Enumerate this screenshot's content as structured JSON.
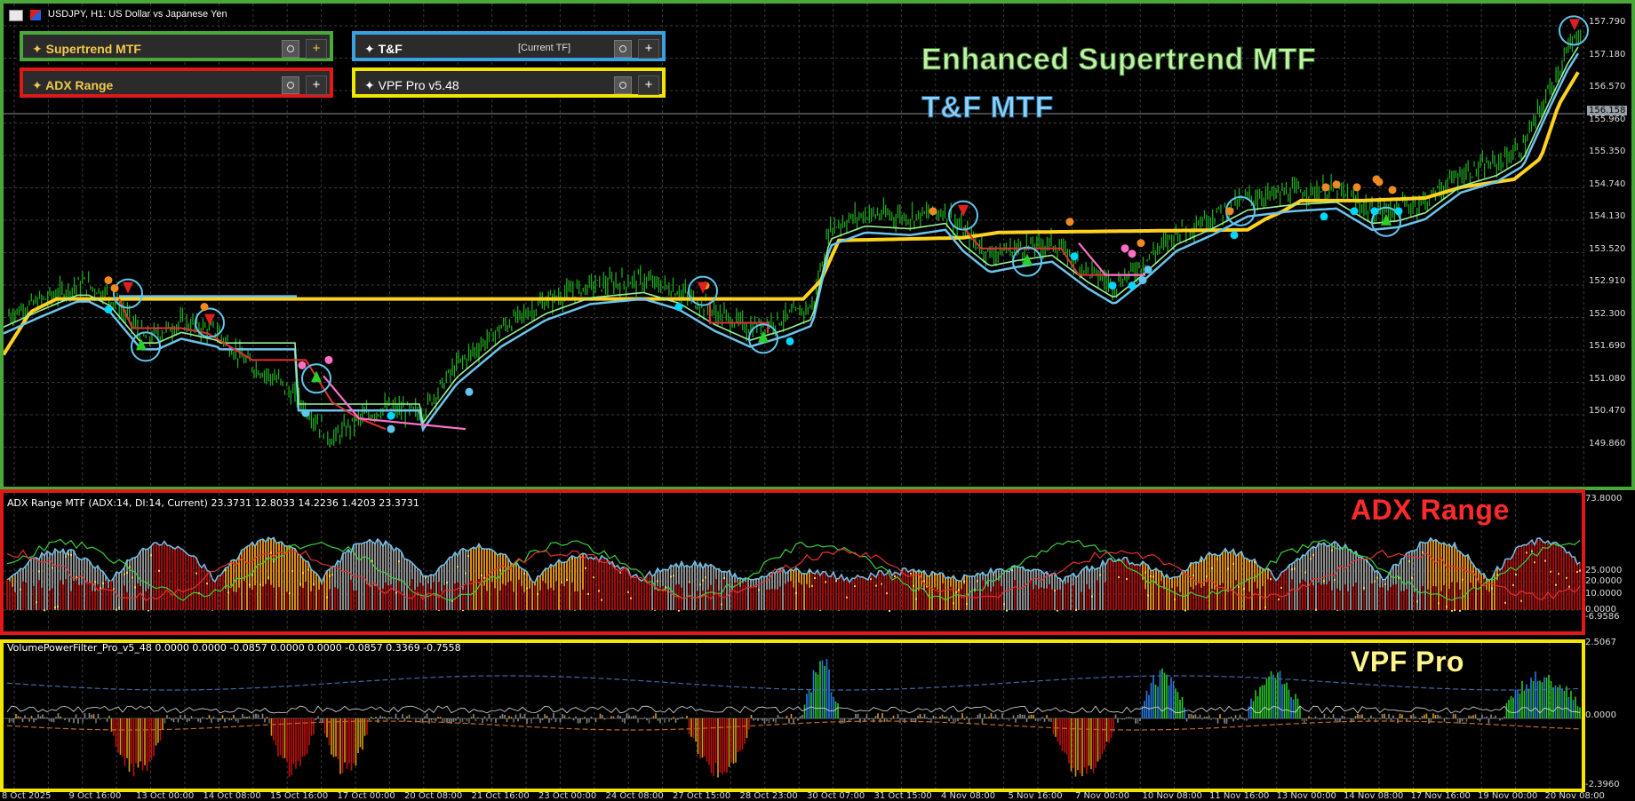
{
  "window": {
    "title": "USDJPY, H1:  US Dollar vs Japanese Yen"
  },
  "indicator_panels": {
    "supertrend": {
      "label": "✦ Supertrend MTF",
      "plus": "+",
      "color": "#f2c94c",
      "border": "#4aa83a"
    },
    "adx": {
      "label": "✦ ADX Range",
      "plus": "+",
      "color": "#f2c94c",
      "border": "#e01818"
    },
    "tf": {
      "label": "✦ T&F",
      "middle": "[Current TF]",
      "plus": "+",
      "color": "#ffffff",
      "border": "#3aa0e0"
    },
    "vpf": {
      "label": "✦ VPF Pro v5.48",
      "plus": "+",
      "color": "#ffffff",
      "border": "#f2e600"
    }
  },
  "overlay_titles": {
    "line1": "Enhanced Supertrend MTF",
    "line2": "T&F MTF",
    "adx": "ADX Range",
    "vpf": "VPF Pro"
  },
  "price_axis": {
    "ticks": [
      "157.790",
      "157.180",
      "156.570",
      "155.960",
      "155.350",
      "154.740",
      "154.130",
      "153.520",
      "152.910",
      "152.300",
      "151.690",
      "151.080",
      "150.470",
      "149.860"
    ],
    "current_price": "156.158"
  },
  "adx_subwindow": {
    "header": "ADX Range MTF (ADX:14, DI:14, Current) 23.3731 12.8033 14.2236 1.4203 23.3731",
    "ticks": [
      "73.8000",
      "25.0000",
      "20.0000",
      "10.0000",
      "0.0000",
      "-6.9586"
    ]
  },
  "vpf_subwindow": {
    "header": "VolumePowerFilter_Pro_v5_48 0.0000 0.0000 -0.0857 0.0000 0.0000 -0.0857 0.3369 -0.7558",
    "ticks": [
      "2.5067",
      "0.0000",
      "-2.3960"
    ]
  },
  "time_axis": [
    "8 Oct 2025",
    "9 Oct 16:00",
    "13 Oct 00:00",
    "14 Oct 08:00",
    "15 Oct 16:00",
    "17 Oct 00:00",
    "20 Oct 08:00",
    "21 Oct 16:00",
    "23 Oct 00:00",
    "24 Oct 08:00",
    "27 Oct 15:00",
    "28 Oct 23:00",
    "30 Oct 07:00",
    "31 Oct 15:00",
    "4 Nov 08:00",
    "5 Nov 16:00",
    "7 Nov 00:00",
    "10 Nov 08:00",
    "11 Nov 16:00",
    "13 Nov 00:00",
    "14 Nov 08:00",
    "17 Nov 16:00",
    "19 Nov 00:00",
    "20 Nov 08:00"
  ],
  "colors": {
    "candle_up": "#1fa81f",
    "supertrend_yellow": "#ffd21f",
    "tf_blue": "#6cc4ee",
    "tf_green": "#9af09a",
    "tf_red": "#e53030",
    "tf_pink": "#ff6fc8",
    "adx_gray": "#8a8a8a",
    "adx_orange": "#d88a14",
    "adx_red": "#a00d0d",
    "grid": "#3a3a3a"
  }
}
